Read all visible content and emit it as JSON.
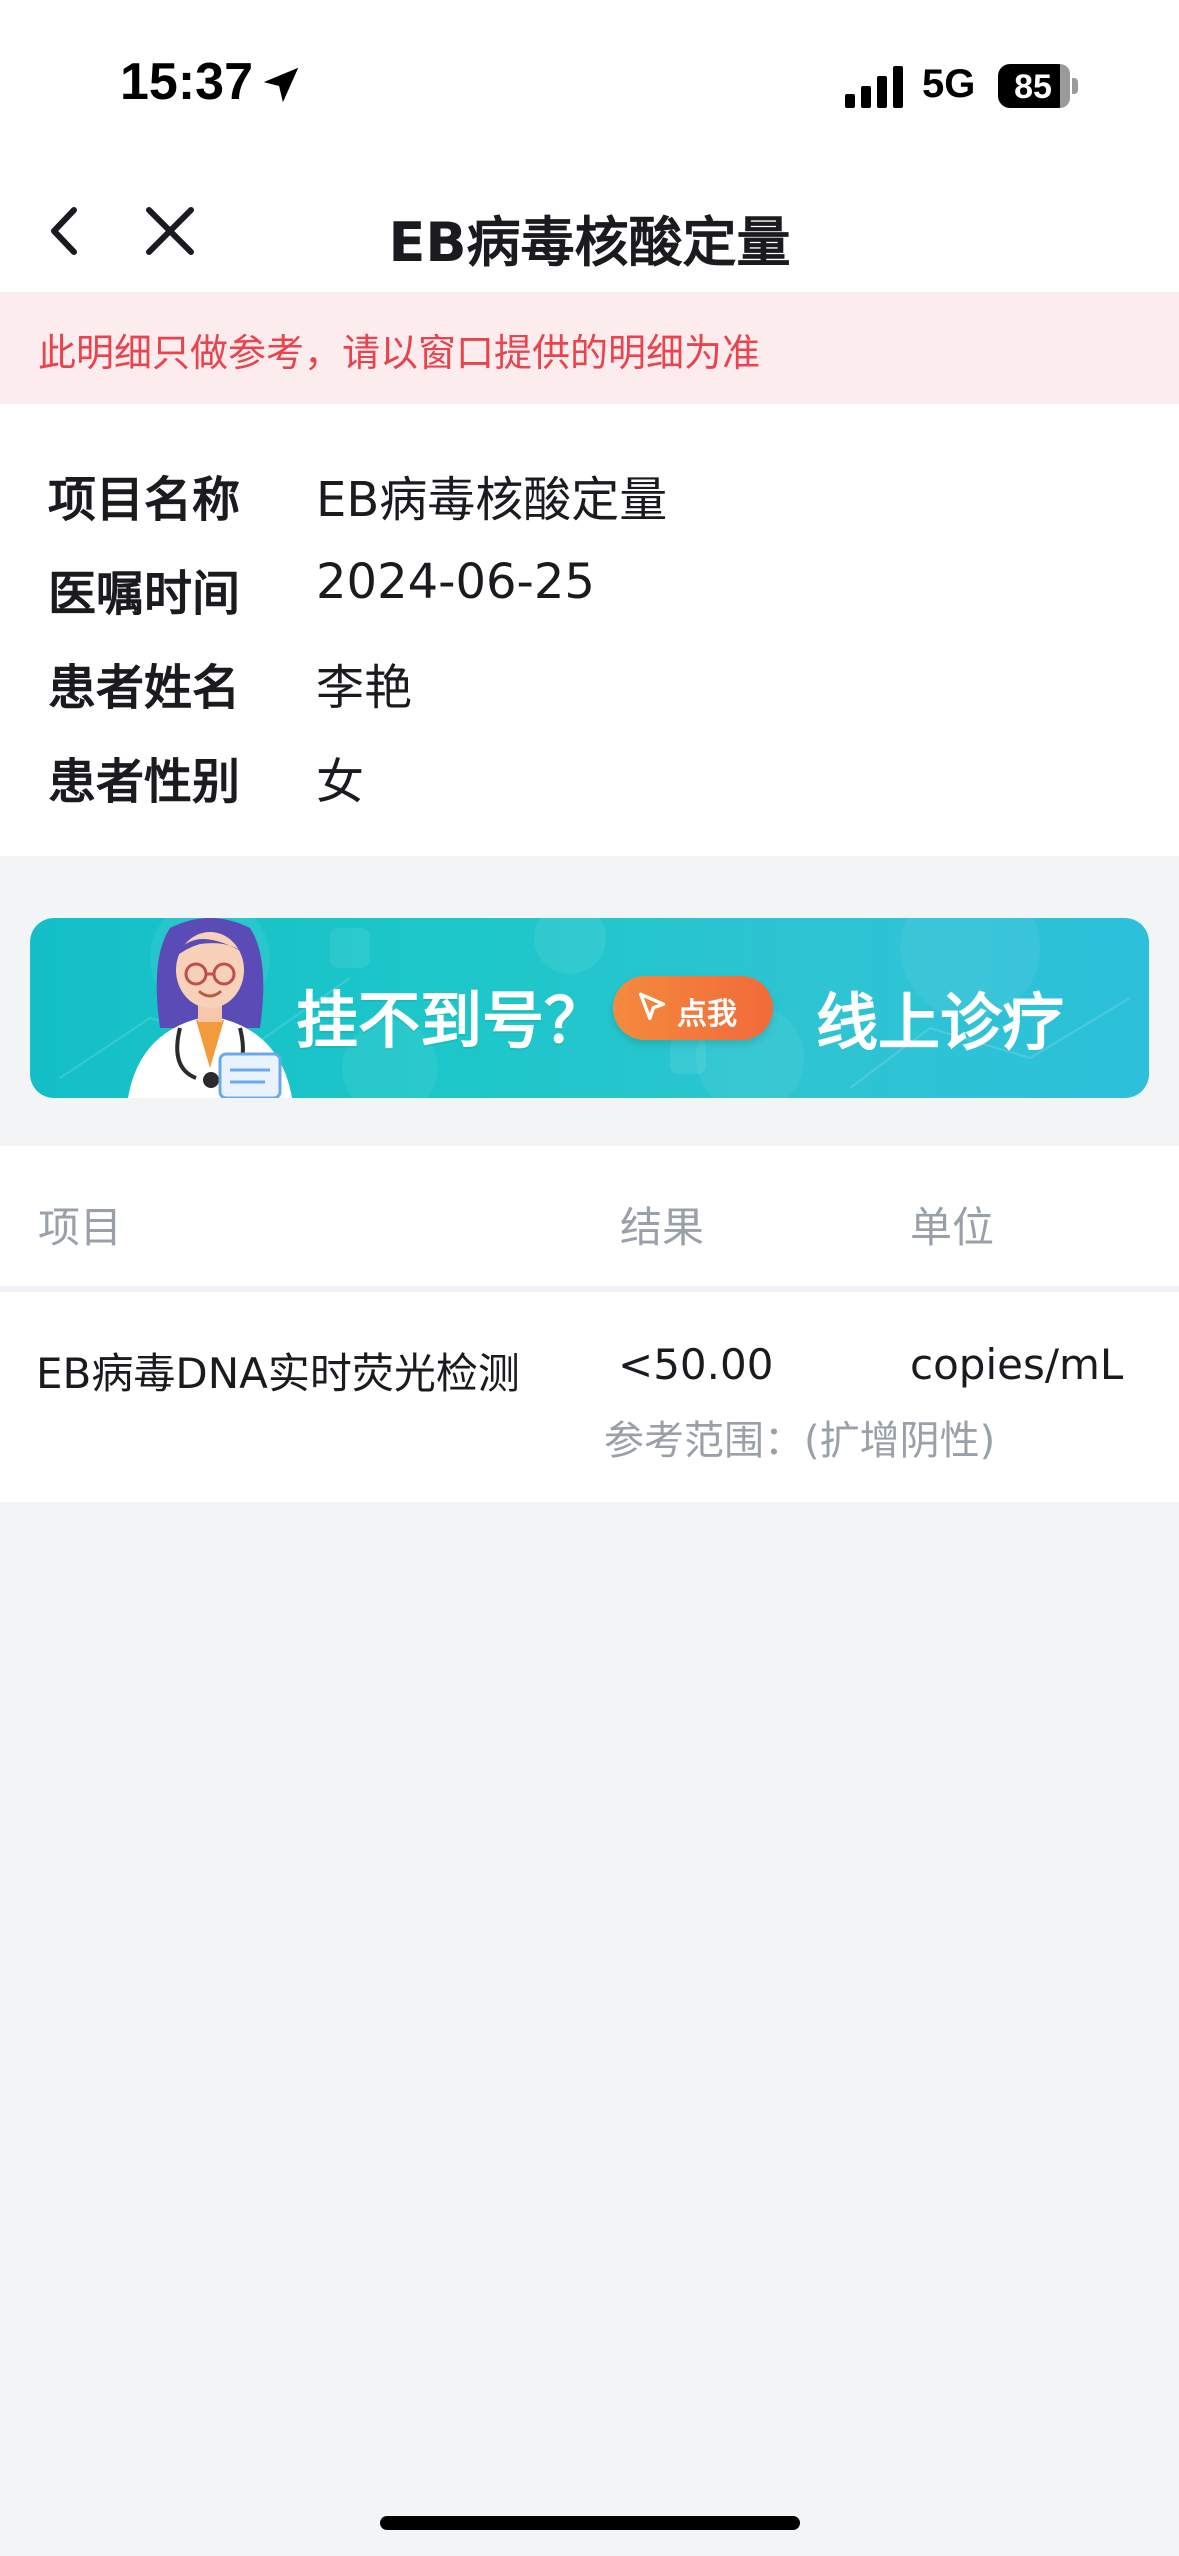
{
  "status_bar": {
    "time": "15:37",
    "network": "5G",
    "battery": "85"
  },
  "nav": {
    "title": "EB病毒核酸定量"
  },
  "notice": {
    "text": "此明细只做参考，请以窗口提供的明细为准"
  },
  "info": {
    "rows": [
      {
        "label": "项目名称",
        "value": "EB病毒核酸定量"
      },
      {
        "label": "医嘱时间",
        "value": "2024-06-25"
      },
      {
        "label": "患者姓名",
        "value": "李艳"
      },
      {
        "label": "患者性别",
        "value": "女"
      }
    ]
  },
  "banner": {
    "question": "挂不到号？",
    "button_label": "点我",
    "cta": "线上诊疗"
  },
  "results": {
    "headers": {
      "item": "项目",
      "result": "结果",
      "unit": "单位"
    },
    "rows": [
      {
        "item": "EB病毒DNA实时荧光检测",
        "result": "<50.00",
        "unit": "copies/mL",
        "reference": "参考范围：(扩增阴性)"
      }
    ]
  },
  "colors": {
    "notice_bg": "#fdeced",
    "notice_text": "#e8444f",
    "banner_teal": "#1dc7c9",
    "banner_button": "#f26a3a",
    "muted_text": "#9aa0aa",
    "page_bg": "#f3f4f6"
  },
  "icons": {
    "location": "location-arrow-icon",
    "signal": "cellular-signal-icon",
    "back": "chevron-left-icon",
    "close": "close-icon",
    "cursor": "cursor-pointer-icon"
  }
}
